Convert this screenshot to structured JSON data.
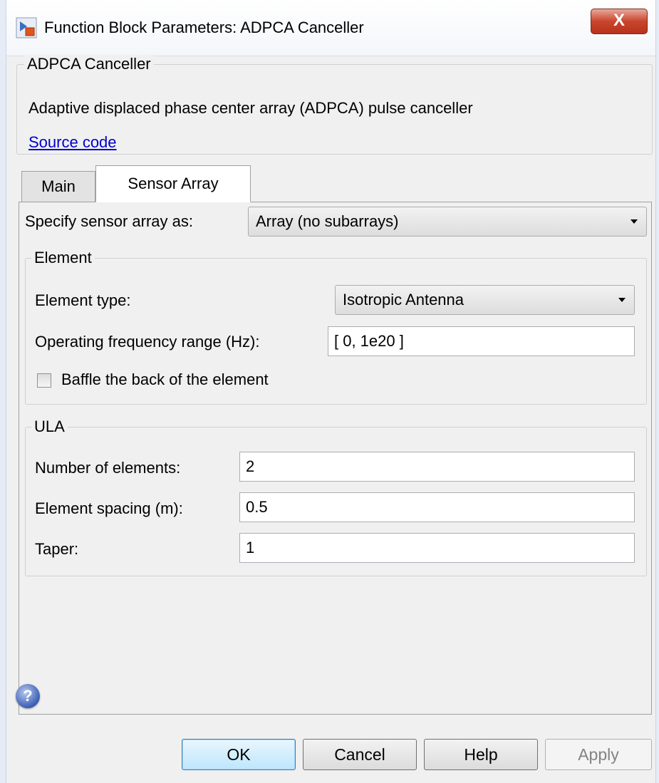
{
  "window": {
    "title": "Function Block Parameters: ADPCA Canceller",
    "close_label": "X"
  },
  "description": {
    "group_label": "ADPCA Canceller",
    "text": "Adaptive displaced phase center array (ADPCA) pulse canceller",
    "source_link": "Source code"
  },
  "tabs": [
    {
      "label": "Main",
      "selected": false
    },
    {
      "label": "Sensor Array",
      "selected": true
    }
  ],
  "sensor_array": {
    "specify_label": "Specify sensor array as:",
    "specify_value": "Array (no subarrays)",
    "element": {
      "group_label": "Element",
      "type_label": "Element type:",
      "type_value": "Isotropic Antenna",
      "freq_label": "Operating frequency range (Hz):",
      "freq_value": "[ 0, 1e20 ]",
      "baffle_label": "Baffle the back of the element",
      "baffle_checked": false
    },
    "ula": {
      "group_label": "ULA",
      "num_label": "Number of elements:",
      "num_value": "2",
      "spacing_label": "Element spacing (m):",
      "spacing_value": "0.5",
      "taper_label": "Taper:",
      "taper_value": "1"
    }
  },
  "buttons": {
    "help_icon": "?",
    "ok": "OK",
    "cancel": "Cancel",
    "help": "Help",
    "apply": "Apply"
  }
}
